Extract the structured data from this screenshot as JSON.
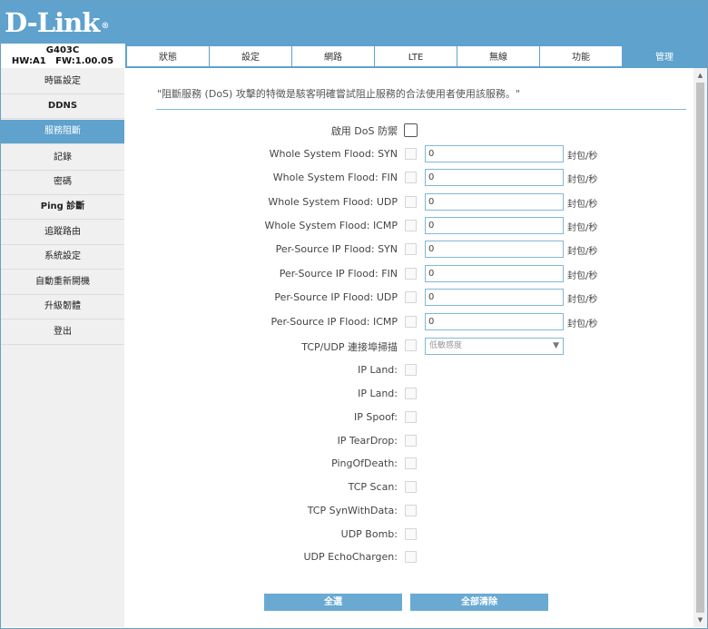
{
  "brand": {
    "logo": "D-Link",
    "tm": "®"
  },
  "device": {
    "model": "G403C",
    "hw": "HW:A1",
    "fw": "FW:1.00.05"
  },
  "tabs": [
    "狀態",
    "設定",
    "網路",
    "LTE",
    "無線",
    "功能",
    "管理"
  ],
  "active_tab": "管理",
  "sidebar": [
    {
      "label": "時區設定"
    },
    {
      "label": "DDNS"
    },
    {
      "label": "服務阻斷"
    },
    {
      "label": "記錄"
    },
    {
      "label": "密碼"
    },
    {
      "label": "Ping 診斷"
    },
    {
      "label": "追蹤路由"
    },
    {
      "label": "系統設定"
    },
    {
      "label": "自動重新開機"
    },
    {
      "label": "升級韌體"
    },
    {
      "label": "登出"
    }
  ],
  "active_sidebar": "服務阻斷",
  "description": "\"阻斷服務 (DoS) 攻擊的特徵是駭客明確嘗試阻止服務的合法使用者使用該服務。\"",
  "enable_dos": {
    "label": "啟用 DoS 防禦",
    "checked": false
  },
  "floods": [
    {
      "label": "Whole System Flood: SYN",
      "value": "0",
      "unit": "封包/秒"
    },
    {
      "label": "Whole System Flood: FIN",
      "value": "0",
      "unit": "封包/秒"
    },
    {
      "label": "Whole System Flood: UDP",
      "value": "0",
      "unit": "封包/秒"
    },
    {
      "label": "Whole System Flood: ICMP",
      "value": "0",
      "unit": "封包/秒"
    },
    {
      "label": "Per-Source IP Flood: SYN",
      "value": "0",
      "unit": "封包/秒"
    },
    {
      "label": "Per-Source IP Flood: FIN",
      "value": "0",
      "unit": "封包/秒"
    },
    {
      "label": "Per-Source IP Flood: UDP",
      "value": "0",
      "unit": "封包/秒"
    },
    {
      "label": "Per-Source IP Flood: ICMP",
      "value": "0",
      "unit": "封包/秒"
    }
  ],
  "port_scan": {
    "label": "TCP/UDP 連接埠掃描",
    "selected": "低敏感度"
  },
  "options": [
    {
      "label": "IP Land:"
    },
    {
      "label": "IP Land:"
    },
    {
      "label": "IP Spoof:"
    },
    {
      "label": "IP TearDrop:"
    },
    {
      "label": "PingOfDeath:"
    },
    {
      "label": "TCP Scan:"
    },
    {
      "label": "TCP SynWithData:"
    },
    {
      "label": "UDP Bomb:"
    },
    {
      "label": "UDP EchoChargen:"
    }
  ],
  "buttons": {
    "select_all": "全選",
    "clear_all": "全部清除"
  },
  "colors": {
    "brand": "#5ea2cd",
    "button": "#6aaad2",
    "input_border": "#7fb8d8"
  }
}
